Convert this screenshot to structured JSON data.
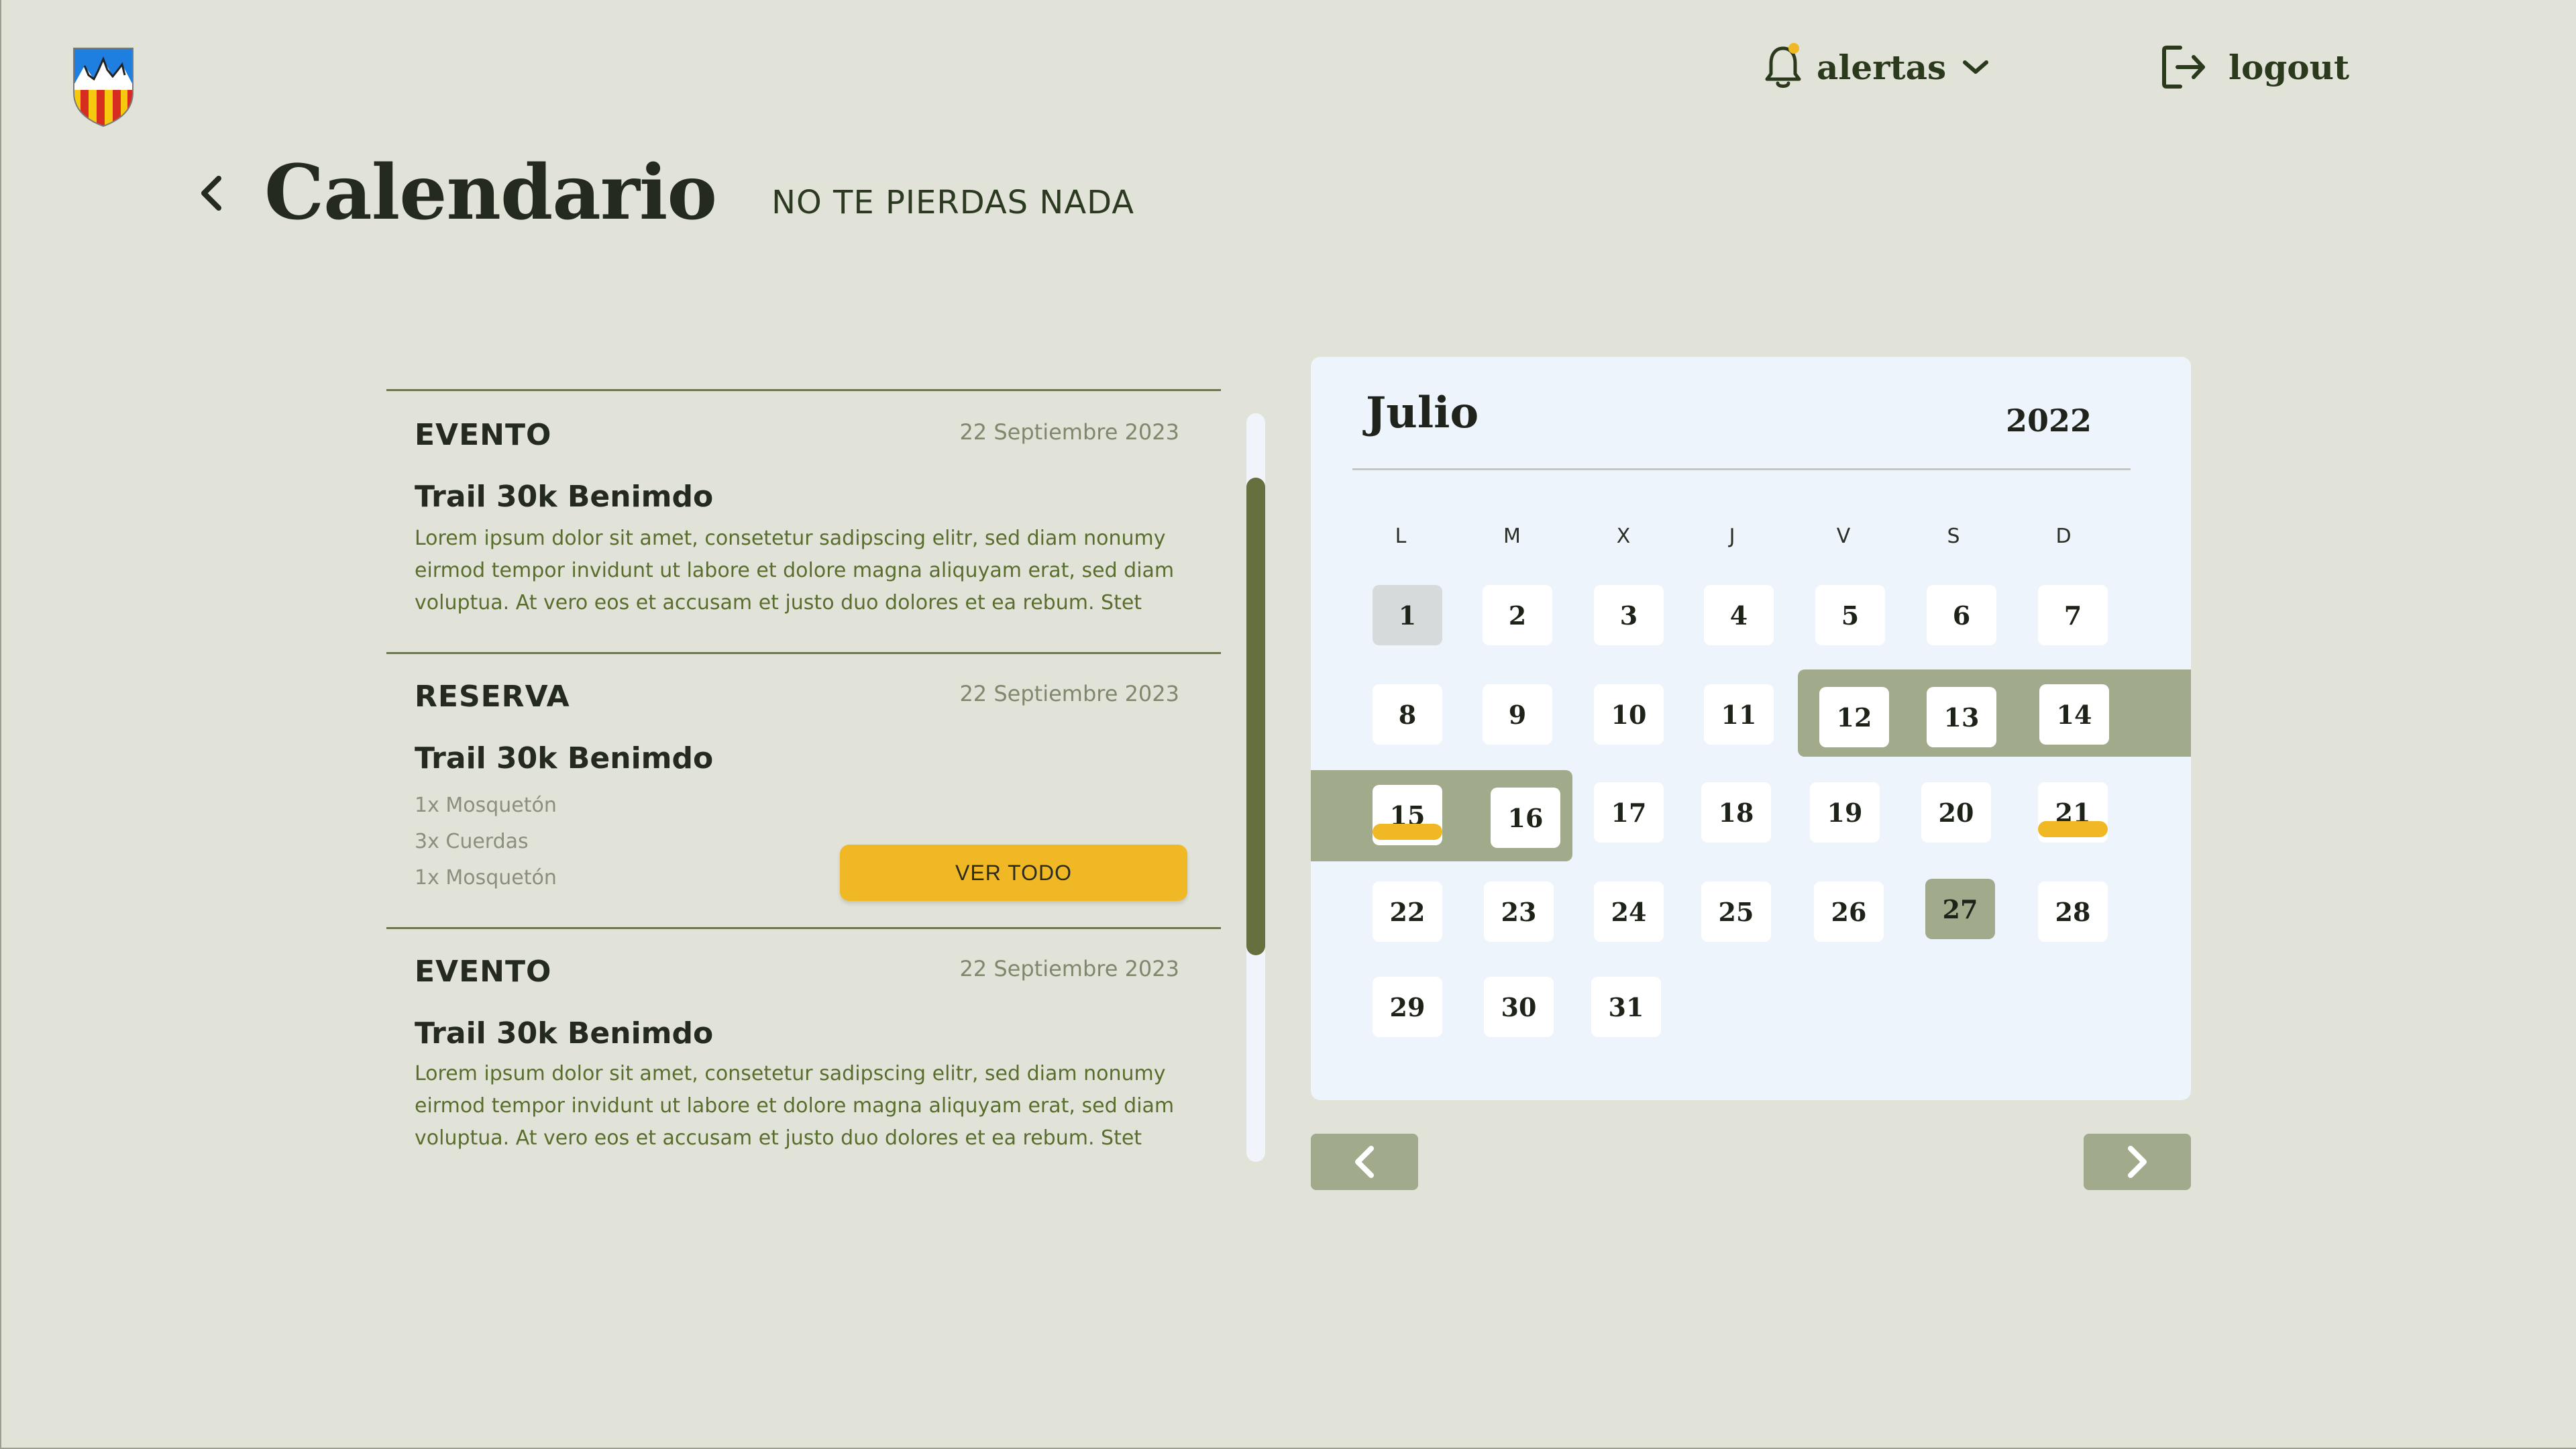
{
  "header": {
    "alerts_label": "alertas",
    "logout_label": "logout",
    "alert_dot_color": "#f0b825"
  },
  "page": {
    "title": "Calendario",
    "subtitle": "NO TE PIERDAS NADA"
  },
  "list": {
    "items": [
      {
        "type": "EVENTO",
        "date": "22 Septiembre 2023",
        "title": "Trail 30k Benimdo",
        "description": "Lorem ipsum dolor sit amet, consetetur sadipscing elitr, sed diam nonumy eirmod tempor invidunt ut labore et dolore magna aliquyam erat, sed diam voluptua. At vero eos et accusam et justo duo dolores et ea rebum. Stet"
      },
      {
        "type": "RESERVA",
        "date": "22 Septiembre 2023",
        "title": "Trail 30k Benimdo",
        "gear": [
          "1x Mosquetón",
          "3x Cuerdas",
          "1x Mosquetón"
        ],
        "button_label": "VER TODO"
      },
      {
        "type": "EVENTO",
        "date": "22 Septiembre 2023",
        "title": "Trail 30k Benimdo",
        "description": "Lorem ipsum dolor sit amet, consetetur sadipscing elitr, sed diam nonumy eirmod tempor invidunt ut labore et dolore magna aliquyam erat, sed diam voluptua. At vero eos et accusam et justo duo dolores et ea rebum. Stet"
      }
    ]
  },
  "calendar": {
    "month": "Julio",
    "year": "2022",
    "weekdays": [
      "L",
      "M",
      "X",
      "J",
      "V",
      "S",
      "D"
    ],
    "days": [
      "1",
      "2",
      "3",
      "4",
      "5",
      "6",
      "7",
      "8",
      "9",
      "10",
      "11",
      "12",
      "13",
      "14",
      "15",
      "16",
      "17",
      "18",
      "19",
      "20",
      "21",
      "22",
      "23",
      "24",
      "25",
      "26",
      "27",
      "28",
      "29",
      "30",
      "31"
    ],
    "today": "1",
    "selected": "27",
    "highlighted_range": [
      "12",
      "13",
      "14",
      "15",
      "16"
    ],
    "event_days": [
      "15",
      "21"
    ]
  },
  "colors": {
    "background": "#e1e3d8",
    "accent_yellow": "#f0b825",
    "olive": "#66703f",
    "sage": "#a1ab8b"
  },
  "icons": {
    "alerts": "bell-icon",
    "alerts_dropdown": "chevron-down-icon",
    "logout": "logout-icon",
    "back": "chevron-left-icon",
    "prev": "chevron-left-icon",
    "next": "chevron-right-icon"
  }
}
